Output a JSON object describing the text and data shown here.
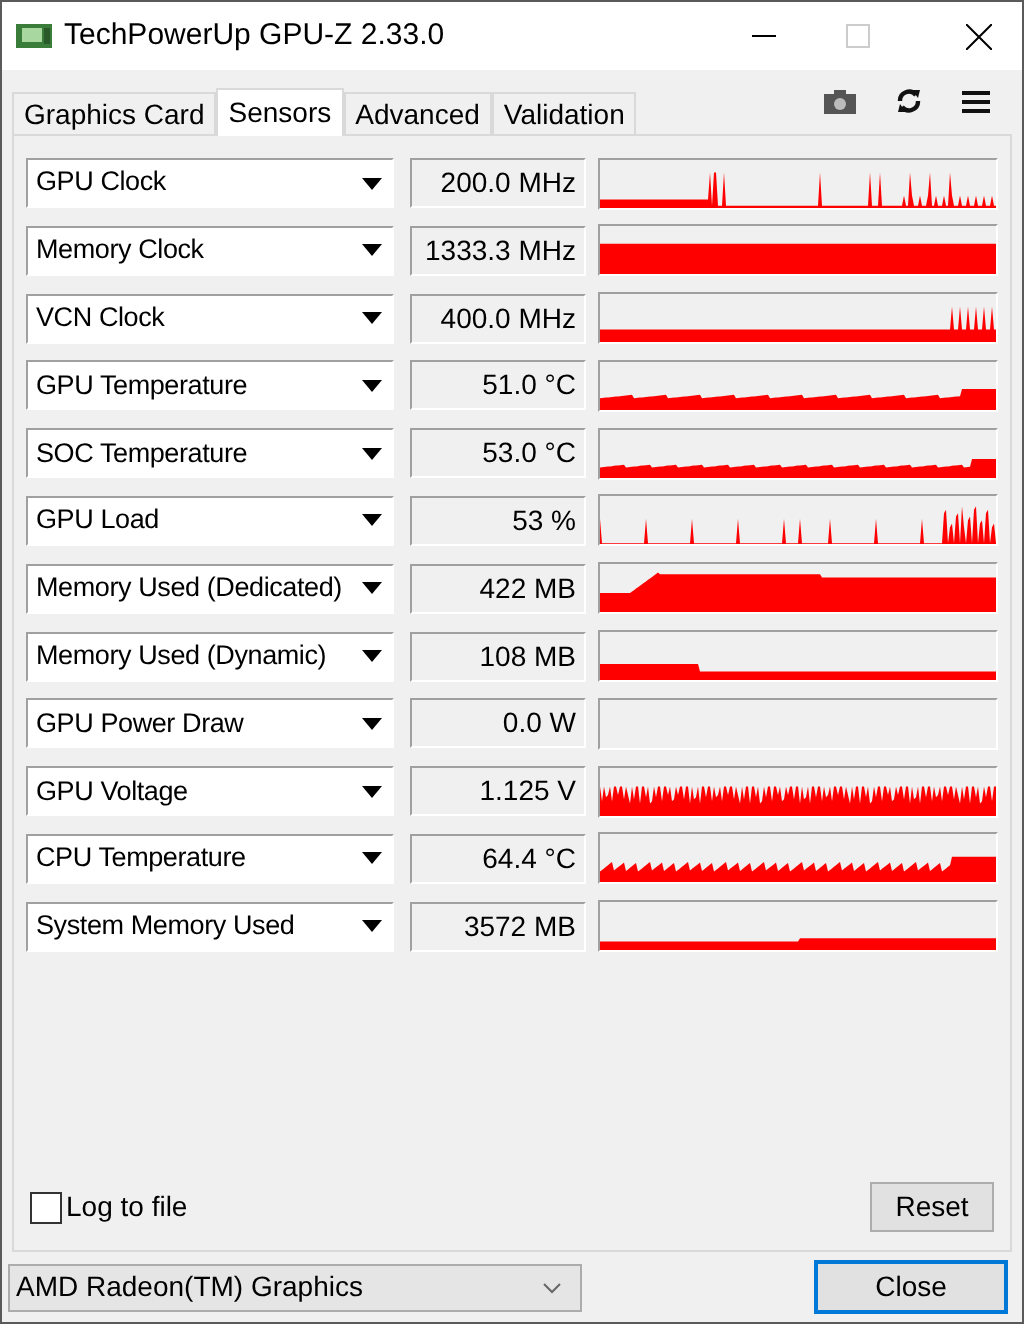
{
  "window": {
    "title": "TechPowerUp GPU-Z 2.33.0"
  },
  "tabs": [
    {
      "label": "Graphics Card",
      "selected": false
    },
    {
      "label": "Sensors",
      "selected": true
    },
    {
      "label": "Advanced",
      "selected": false
    },
    {
      "label": "Validation",
      "selected": false
    }
  ],
  "sensors": [
    {
      "name": "GPU Clock",
      "reading": "200.0 MHz"
    },
    {
      "name": "Memory Clock",
      "reading": "1333.3 MHz"
    },
    {
      "name": "VCN Clock",
      "reading": "400.0 MHz"
    },
    {
      "name": "GPU Temperature",
      "reading": "51.0 °C"
    },
    {
      "name": "SOC Temperature",
      "reading": "53.0 °C"
    },
    {
      "name": "GPU Load",
      "reading": "53 %"
    },
    {
      "name": "Memory Used (Dedicated)",
      "reading": "422 MB"
    },
    {
      "name": "Memory Used (Dynamic)",
      "reading": "108 MB"
    },
    {
      "name": "GPU Power Draw",
      "reading": "0.0 W"
    },
    {
      "name": "GPU Voltage",
      "reading": "1.125 V"
    },
    {
      "name": "CPU Temperature",
      "reading": "64.4 °C"
    },
    {
      "name": "System Memory Used",
      "reading": "3572 MB"
    }
  ],
  "log_to_file": {
    "label": "Log to file",
    "checked": false
  },
  "reset_button": "Reset",
  "gpu_select": {
    "value": "AMD Radeon(TM) Graphics"
  },
  "close_button": "Close"
}
